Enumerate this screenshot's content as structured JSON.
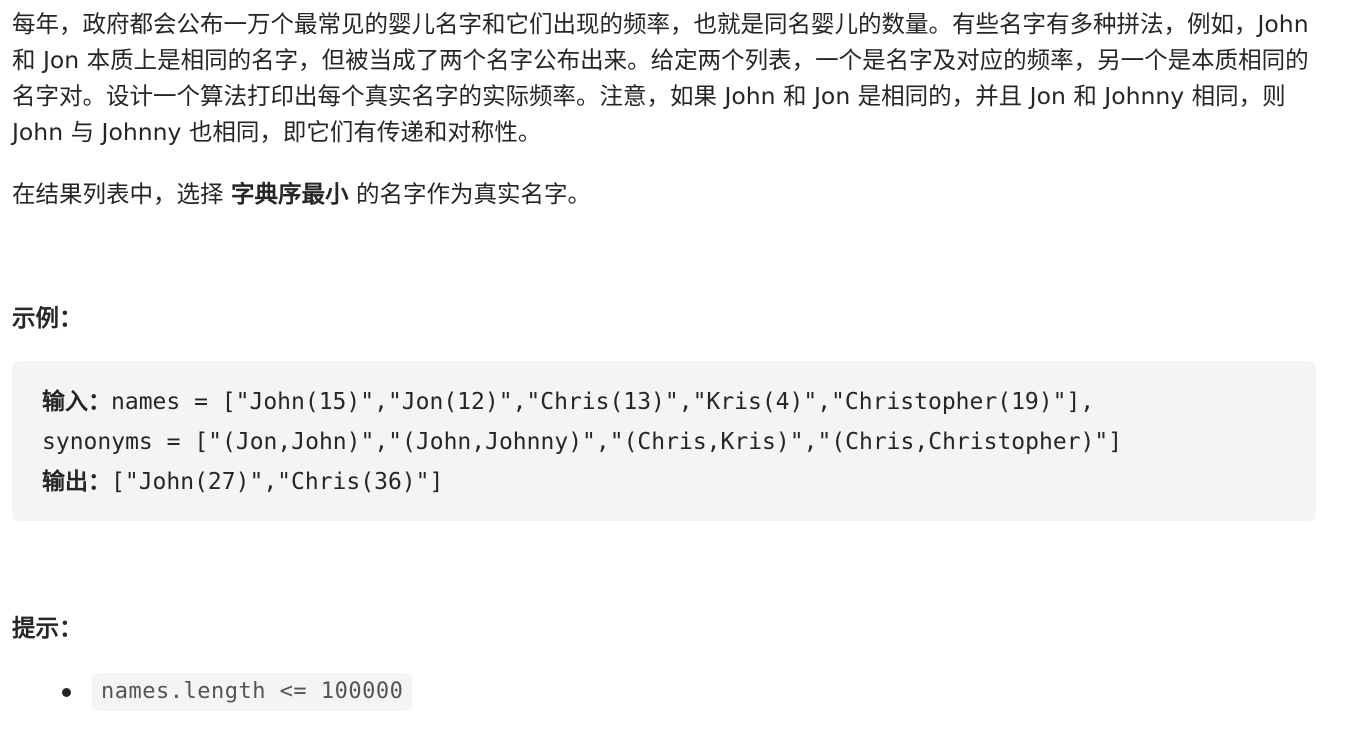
{
  "description": {
    "paragraph1": "每年，政府都会公布一万个最常见的婴儿名字和它们出现的频率，也就是同名婴儿的数量。有些名字有多种拼法，例如，John 和 Jon 本质上是相同的名字，但被当成了两个名字公布出来。给定两个列表，一个是名字及对应的频率，另一个是本质相同的名字对。设计一个算法打印出每个真实名字的实际频率。注意，如果 John 和 Jon 是相同的，并且 Jon 和 Johnny 相同，则 John 与 Johnny 也相同，即它们有传递和对称性。",
    "paragraph2_prefix": "在结果列表中，选择 ",
    "paragraph2_strong": "字典序最小",
    "paragraph2_suffix": " 的名字作为真实名字。"
  },
  "example": {
    "title": "示例：",
    "input_label": "输入：",
    "input_line1": "names = [\"John(15)\",\"Jon(12)\",\"Chris(13)\",\"Kris(4)\",\"Christopher(19)\"],",
    "input_line2": "synonyms = [\"(Jon,John)\",\"(John,Johnny)\",\"(Chris,Kris)\",\"(Chris,Christopher)\"]",
    "output_label": "输出：",
    "output_value": "[\"John(27)\",\"Chris(36)\"]"
  },
  "hints": {
    "title": "提示：",
    "items": [
      "names.length <= 100000"
    ]
  }
}
